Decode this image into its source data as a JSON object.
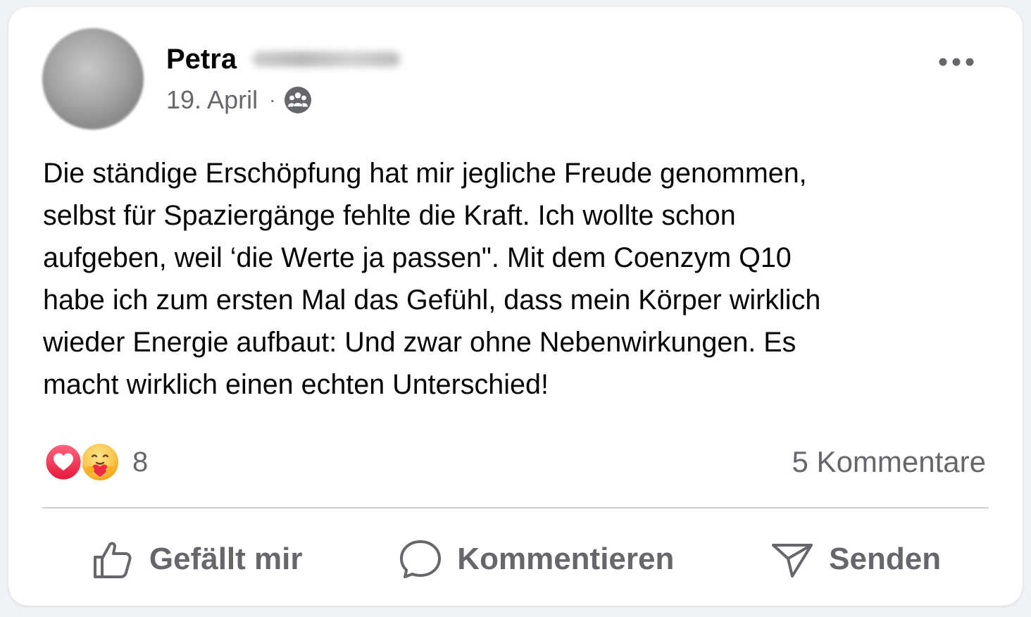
{
  "post": {
    "author_first_name": "Petra",
    "date": "19. April",
    "separator": "·",
    "audience_icon": "group-icon",
    "text": "Die ständige Erschöpfung hat mir jegliche Freude genommen,\nselbst für Spaziergänge fehlte die Kraft. Ich wollte schon\naufgeben, weil ‘die Werte ja passen\". Mit dem Coenzym Q10\nhabe ich zum ersten Mal das Gefühl, dass mein Körper wirklich\nwieder Energie aufbaut: Und zwar ohne Nebenwirkungen. Es\nmacht wirklich einen echten Unterschied!"
  },
  "reactions": {
    "types": [
      "love-reaction-icon",
      "care-reaction-icon"
    ],
    "count": "8",
    "comments": "5 Kommentare"
  },
  "actions": {
    "like_label": "Gefällt mir",
    "comment_label": "Kommentieren",
    "send_label": "Senden"
  },
  "colors": {
    "text_primary": "#050505",
    "text_secondary": "#65676b",
    "love_red": "#f33e58",
    "care_yellow": "#f7b125",
    "divider": "#ced0d4"
  }
}
